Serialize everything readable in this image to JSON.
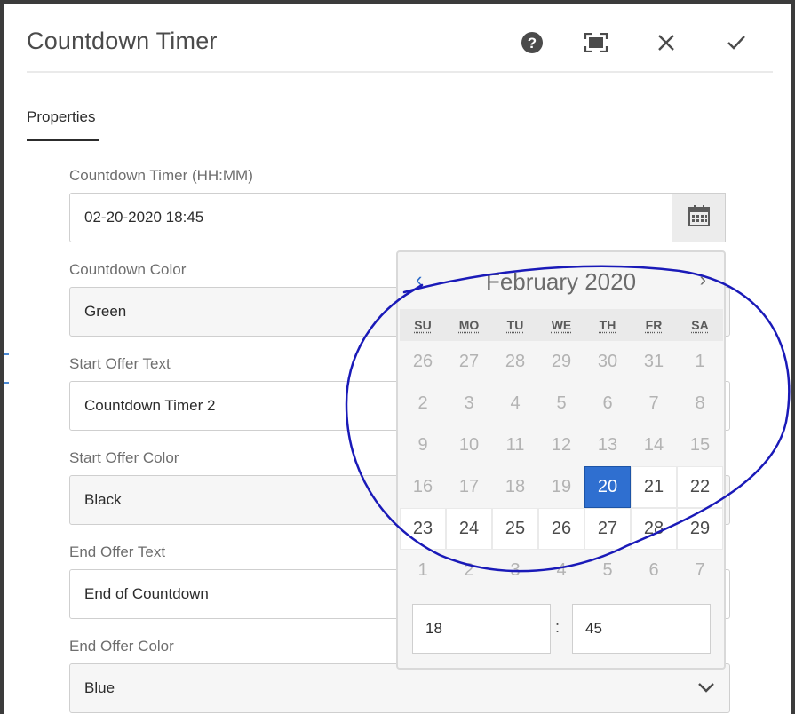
{
  "dialog": {
    "title": "Countdown Timer",
    "actions": [
      "help-icon",
      "fullscreen-icon",
      "close-icon",
      "confirm-icon"
    ]
  },
  "tabs": [
    {
      "label": "Properties",
      "active": true
    }
  ],
  "fields": {
    "countdown_timer": {
      "label": "Countdown Timer (HH:MM)",
      "value": "02-20-2020 18:45"
    },
    "countdown_color": {
      "label": "Countdown Color",
      "value": "Green"
    },
    "start_offer_text": {
      "label": "Start Offer Text",
      "value": "Countdown Timer 2"
    },
    "start_offer_color": {
      "label": "Start Offer Color",
      "value": "Black"
    },
    "end_offer_text": {
      "label": "End Offer Text",
      "value": "End of Countdown"
    },
    "end_offer_color": {
      "label": "End Offer Color",
      "value": "Blue"
    }
  },
  "calendar": {
    "month_title": "February 2020",
    "prev_glyph": "‹",
    "next_glyph": "›",
    "weekdays": [
      "SU",
      "MO",
      "TU",
      "WE",
      "TH",
      "FR",
      "SA"
    ],
    "days": [
      {
        "label": "26",
        "in_month": false
      },
      {
        "label": "27",
        "in_month": false
      },
      {
        "label": "28",
        "in_month": false
      },
      {
        "label": "29",
        "in_month": false
      },
      {
        "label": "30",
        "in_month": false
      },
      {
        "label": "31",
        "in_month": false
      },
      {
        "label": "1",
        "in_month": false
      },
      {
        "label": "2",
        "in_month": false
      },
      {
        "label": "3",
        "in_month": false
      },
      {
        "label": "4",
        "in_month": false
      },
      {
        "label": "5",
        "in_month": false
      },
      {
        "label": "6",
        "in_month": false
      },
      {
        "label": "7",
        "in_month": false
      },
      {
        "label": "8",
        "in_month": false
      },
      {
        "label": "9",
        "in_month": false
      },
      {
        "label": "10",
        "in_month": false
      },
      {
        "label": "11",
        "in_month": false
      },
      {
        "label": "12",
        "in_month": false
      },
      {
        "label": "13",
        "in_month": false
      },
      {
        "label": "14",
        "in_month": false
      },
      {
        "label": "15",
        "in_month": false
      },
      {
        "label": "16",
        "in_month": false
      },
      {
        "label": "17",
        "in_month": false
      },
      {
        "label": "18",
        "in_month": false
      },
      {
        "label": "19",
        "in_month": false
      },
      {
        "label": "20",
        "in_month": true,
        "selected": true
      },
      {
        "label": "21",
        "in_month": true
      },
      {
        "label": "22",
        "in_month": true
      },
      {
        "label": "23",
        "in_month": true
      },
      {
        "label": "24",
        "in_month": true
      },
      {
        "label": "25",
        "in_month": true
      },
      {
        "label": "26",
        "in_month": true
      },
      {
        "label": "27",
        "in_month": true
      },
      {
        "label": "28",
        "in_month": true
      },
      {
        "label": "29",
        "in_month": true
      },
      {
        "label": "1",
        "in_month": false
      },
      {
        "label": "2",
        "in_month": false
      },
      {
        "label": "3",
        "in_month": false
      },
      {
        "label": "4",
        "in_month": false
      },
      {
        "label": "5",
        "in_month": false
      },
      {
        "label": "6",
        "in_month": false
      },
      {
        "label": "7",
        "in_month": false
      }
    ],
    "hour": "18",
    "time_separator": ":",
    "minute": "45"
  },
  "colors": {
    "accent": "#2f6fd0",
    "annotation_ink": "#1a1ab8"
  }
}
